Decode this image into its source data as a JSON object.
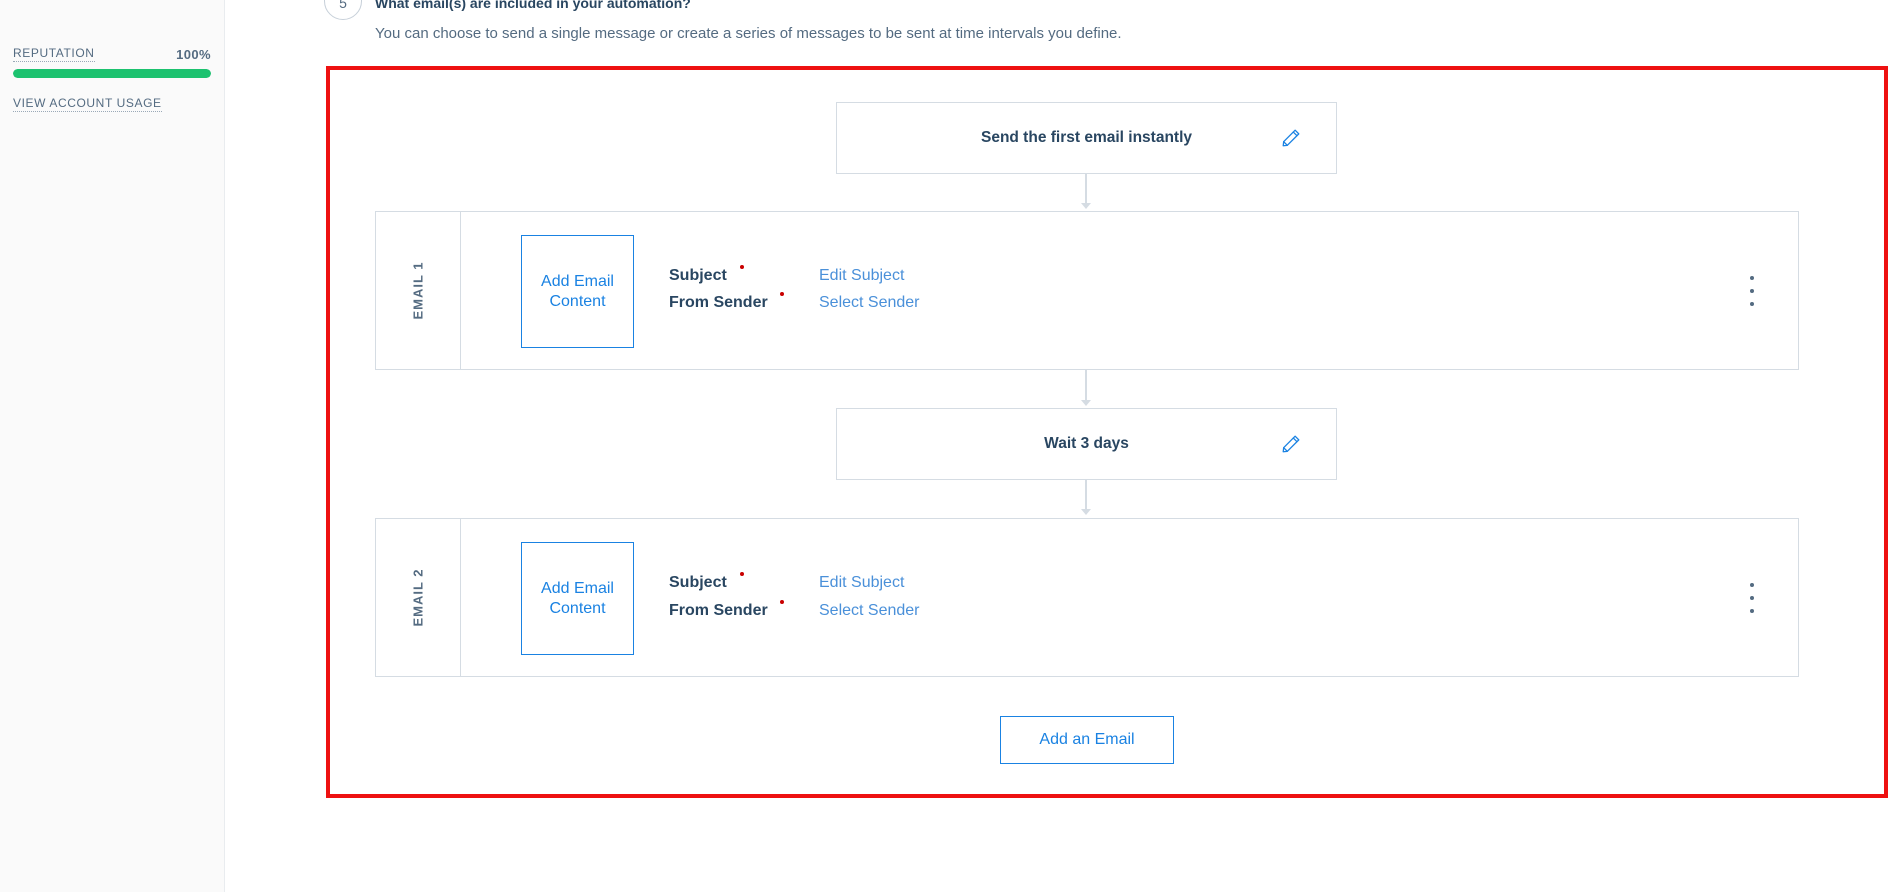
{
  "sidebar": {
    "reputation_label": "REPUTATION",
    "reputation_value": "100%",
    "reputation_fraction": 1.0,
    "usage_link": "VIEW ACCOUNT USAGE"
  },
  "step": {
    "number": "5",
    "title": "What email(s) are included in your automation?",
    "description": "You can choose to send a single message or create a series of messages to be sent at time intervals you define."
  },
  "trigger": {
    "text": "Send the first email instantly",
    "edit_icon": "pencil-icon"
  },
  "wait": {
    "text": "Wait 3 days",
    "edit_icon": "pencil-icon"
  },
  "emails": [
    {
      "label": "EMAIL 1",
      "content_button": "Add Email Content",
      "subject_label": "Subject",
      "subject_link": "Edit Subject",
      "sender_label": "From Sender",
      "sender_link": "Select Sender",
      "menu_icon": "kebab-menu-icon"
    },
    {
      "label": "EMAIL 2",
      "content_button": "Add Email Content",
      "subject_label": "Subject",
      "subject_link": "Edit Subject",
      "sender_label": "From Sender",
      "sender_link": "Select Sender",
      "menu_icon": "kebab-menu-icon"
    }
  ],
  "add_email_button": "Add an Email",
  "colors": {
    "highlight_frame": "#ee1111",
    "reputation_bar": "#1cc26f",
    "link": "#4a90d9",
    "primary": "#1a82e2",
    "required_dot": "#c90000"
  }
}
